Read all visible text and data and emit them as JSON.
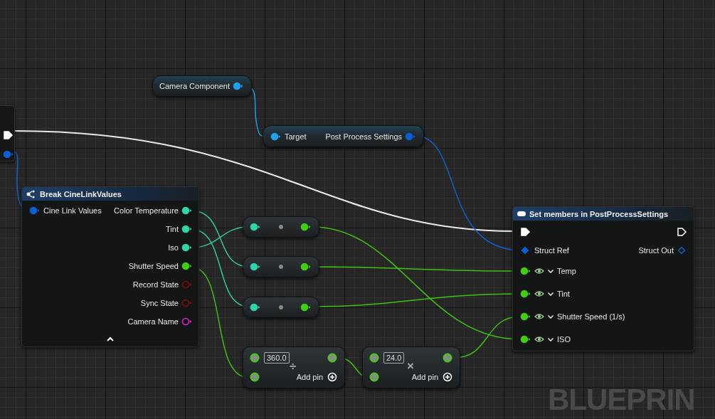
{
  "watermark": "BLUEPRIN",
  "nodes": [
    {
      "kind": "stub",
      "outputs": [
        {
          "kind": "exec",
          "connected": true
        },
        {
          "kind": "round",
          "color": "#0a5fd6",
          "connected": true
        }
      ]
    },
    {
      "kind": "getter",
      "label": "Camera Component",
      "outputs": [
        {
          "kind": "round",
          "color": "#1aa3f0",
          "connected": true
        }
      ]
    },
    {
      "kind": "call",
      "inputs": [
        {
          "label": "Target",
          "kind": "round",
          "color": "#1aa3f0",
          "connected": true
        }
      ],
      "outputs": [
        {
          "label": "Post Process Settings",
          "kind": "round",
          "color": "#0a5fd6",
          "connected": true
        }
      ]
    },
    {
      "kind": "break",
      "title": "Break CineLinkValues",
      "inputs": [
        {
          "label": "Cine Link Values",
          "kind": "round",
          "color": "#0a5fd6",
          "connected": true
        }
      ],
      "outputs": [
        {
          "label": "Color Temperature",
          "kind": "round",
          "color": "#2fd6a8",
          "connected": true
        },
        {
          "label": "Tint",
          "kind": "round",
          "color": "#2fd6a8",
          "connected": true
        },
        {
          "label": "Iso",
          "kind": "round",
          "color": "#2fd6a8",
          "connected": true
        },
        {
          "label": "Shutter Speed",
          "kind": "round",
          "color": "#3fcf10",
          "connected": true
        },
        {
          "label": "Record State",
          "kind": "round",
          "color": "#8a0a0a",
          "connected": false
        },
        {
          "label": "Sync State",
          "kind": "round",
          "color": "#8a0a0a",
          "connected": false
        },
        {
          "label": "Camera Name",
          "kind": "round",
          "color": "#e020d0",
          "connected": false
        }
      ]
    },
    {
      "kind": "convert",
      "inputs": [
        {
          "kind": "round",
          "color": "#2fd6a8",
          "connected": true
        }
      ],
      "outputs": [
        {
          "kind": "round",
          "color": "#3fcf10",
          "connected": true
        }
      ]
    },
    {
      "kind": "convert",
      "inputs": [
        {
          "kind": "round",
          "color": "#2fd6a8",
          "connected": true
        }
      ],
      "outputs": [
        {
          "kind": "round",
          "color": "#3fcf10",
          "connected": true
        }
      ]
    },
    {
      "kind": "convert",
      "inputs": [
        {
          "kind": "round",
          "color": "#2fd6a8",
          "connected": true
        }
      ],
      "outputs": [
        {
          "kind": "round",
          "color": "#3fcf10",
          "connected": true
        }
      ]
    },
    {
      "kind": "math",
      "value": "360.0",
      "operator": "÷",
      "add_pin": "Add pin"
    },
    {
      "kind": "math",
      "value": "24.0",
      "operator": "×",
      "add_pin": "Add pin"
    },
    {
      "kind": "set",
      "title": "Set members in PostProcessSettings",
      "inputs": [
        {
          "kind": "exec",
          "connected": true
        },
        {
          "label": "Struct Ref",
          "kind": "diamond",
          "connected": true
        }
      ],
      "outputs": [
        {
          "kind": "exec",
          "connected": false
        },
        {
          "label": "Struct Out",
          "kind": "diamond",
          "connected": false
        }
      ],
      "members": [
        {
          "label": "Temp",
          "color": "#3fcf10",
          "connected": true
        },
        {
          "label": "Tint",
          "color": "#3fcf10",
          "connected": true
        },
        {
          "label": "Shutter Speed (1/s)",
          "color": "#3fcf10",
          "connected": true
        },
        {
          "label": "ISO",
          "color": "#3fcf10",
          "connected": true
        }
      ]
    }
  ]
}
